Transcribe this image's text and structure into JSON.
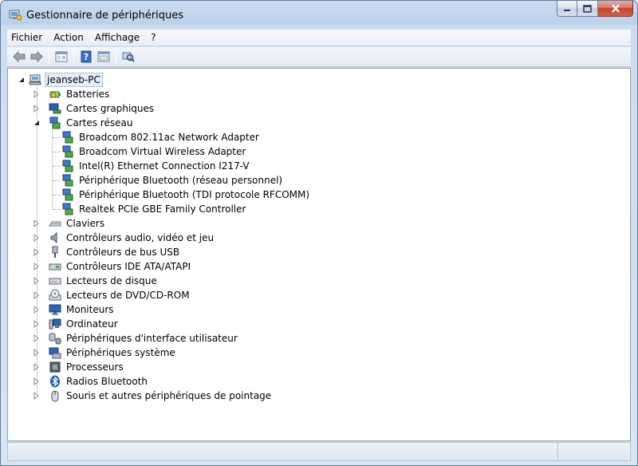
{
  "window": {
    "title": "Gestionnaire de périphériques"
  },
  "menu": [
    {
      "label": "Fichier"
    },
    {
      "label": "Action"
    },
    {
      "label": "Affichage"
    },
    {
      "label": "?"
    }
  ],
  "toolbar": {
    "buttons": [
      {
        "name": "back-icon"
      },
      {
        "name": "forward-icon"
      },
      {
        "name": "console-tree-icon"
      },
      {
        "name": "help-icon"
      },
      {
        "name": "properties-icon"
      },
      {
        "name": "scan-hardware-icon"
      }
    ]
  },
  "tree": {
    "root": {
      "label": "jeanseb-PC",
      "icon": "computer-icon",
      "expanded": true
    },
    "categories": [
      {
        "label": "Batteries",
        "icon": "battery-icon",
        "expanded": false
      },
      {
        "label": "Cartes graphiques",
        "icon": "display-adapter-icon",
        "expanded": false
      },
      {
        "label": "Cartes réseau",
        "icon": "network-adapter-icon",
        "expanded": true,
        "children": [
          {
            "label": "Broadcom 802.11ac Network Adapter",
            "icon": "network-adapter-icon"
          },
          {
            "label": "Broadcom Virtual Wireless Adapter",
            "icon": "network-adapter-icon"
          },
          {
            "label": "Intel(R) Ethernet Connection I217-V",
            "icon": "network-adapter-icon"
          },
          {
            "label": "Périphérique Bluetooth (réseau personnel)",
            "icon": "network-adapter-icon"
          },
          {
            "label": "Périphérique Bluetooth (TDI protocole RFCOMM)",
            "icon": "network-adapter-icon"
          },
          {
            "label": "Realtek PCIe GBE Family Controller",
            "icon": "network-adapter-icon"
          }
        ]
      },
      {
        "label": "Claviers",
        "icon": "keyboard-icon",
        "expanded": false
      },
      {
        "label": "Contrôleurs audio, vidéo et jeu",
        "icon": "speaker-icon",
        "expanded": false
      },
      {
        "label": "Contrôleurs de bus USB",
        "icon": "usb-icon",
        "expanded": false
      },
      {
        "label": "Contrôleurs IDE ATA/ATAPI",
        "icon": "ide-controller-icon",
        "expanded": false
      },
      {
        "label": "Lecteurs de disque",
        "icon": "disk-drive-icon",
        "expanded": false
      },
      {
        "label": "Lecteurs de DVD/CD-ROM",
        "icon": "dvd-drive-icon",
        "expanded": false
      },
      {
        "label": "Moniteurs",
        "icon": "monitor-icon",
        "expanded": false
      },
      {
        "label": "Ordinateur",
        "icon": "computer-monitor-icon",
        "expanded": false
      },
      {
        "label": "Périphériques d'interface utilisateur",
        "icon": "hid-icon",
        "expanded": false
      },
      {
        "label": "Périphériques système",
        "icon": "system-device-icon",
        "expanded": false
      },
      {
        "label": "Processeurs",
        "icon": "processor-icon",
        "expanded": false
      },
      {
        "label": "Radios Bluetooth",
        "icon": "bluetooth-icon",
        "expanded": false
      },
      {
        "label": "Souris et autres périphériques de pointage",
        "icon": "mouse-icon",
        "expanded": false
      }
    ]
  }
}
